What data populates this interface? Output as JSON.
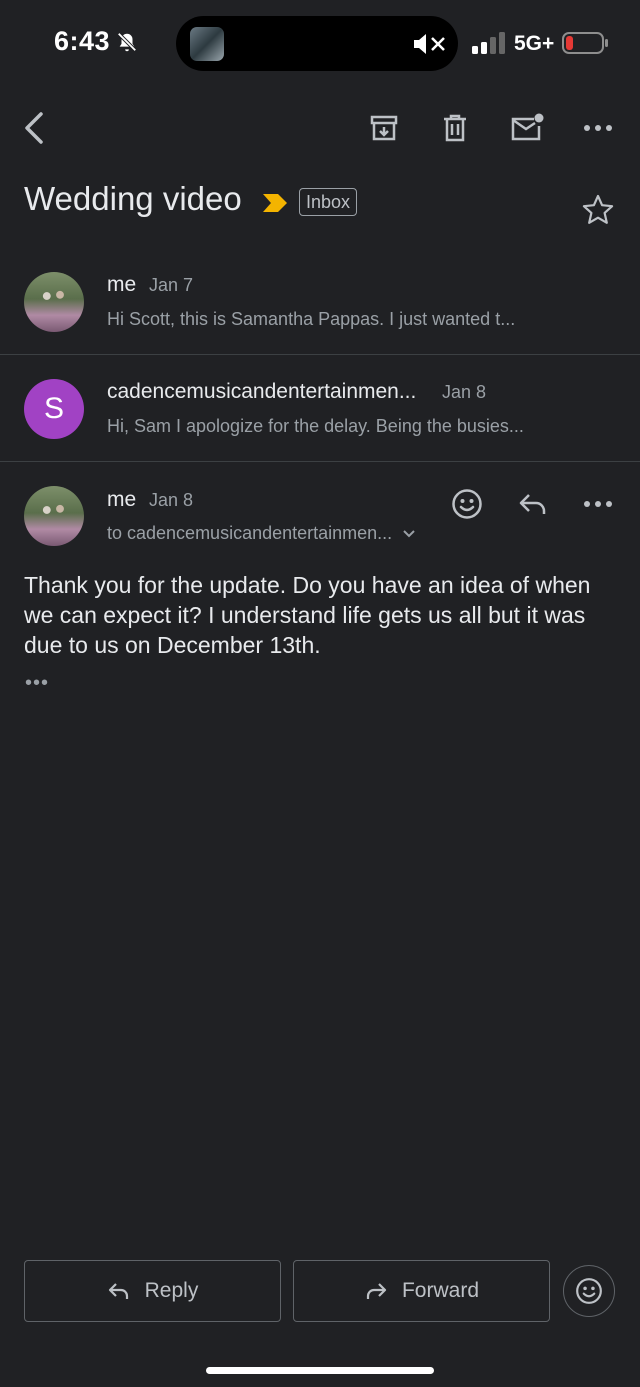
{
  "status_bar": {
    "time": "6:43",
    "network": "5G+",
    "icons": [
      "bell-slash-icon",
      "mute-icon",
      "bluetooth-icon",
      "signal-icon",
      "battery-low-icon"
    ],
    "battery_color": "#e53935"
  },
  "toolbar": {
    "icons": [
      "back-icon",
      "archive-icon",
      "trash-icon",
      "mark-unread-icon",
      "more-icon"
    ]
  },
  "thread": {
    "subject": "Wedding video",
    "label": "Inbox",
    "important_color": "#f4b400"
  },
  "messages": [
    {
      "sender": "me",
      "date": "Jan 7",
      "snippet": "Hi Scott, this is Samantha Pappas. I just wanted t..."
    },
    {
      "sender": "cadencemusicandentertainmen...",
      "avatar_letter": "S",
      "avatar_color": "#a142c4",
      "date": "Jan 8",
      "snippet": "Hi, Sam I apologize for the delay. Being the busies..."
    }
  ],
  "expanded_message": {
    "sender": "me",
    "date": "Jan 8",
    "recipient": "to cadencemusicandentertainmen...",
    "body": "Thank you for the update. Do you have an idea of when we can expect it? I understand life gets us all but it was due to us on December 13th.",
    "trimmed": "•••"
  },
  "actions": {
    "reply": "Reply",
    "forward": "Forward"
  }
}
